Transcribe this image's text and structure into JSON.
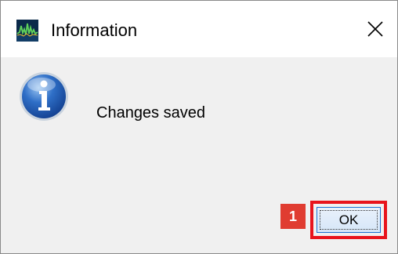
{
  "window": {
    "title": "Information",
    "app_icon": "waveform-app-icon",
    "close_icon": "close-icon"
  },
  "dialog": {
    "icon": "information-icon",
    "message": "Changes saved",
    "ok_label": "OK"
  },
  "annotation": {
    "step_number": "1",
    "badge_color": "#e03c31",
    "highlight_color": "#e8141c"
  }
}
